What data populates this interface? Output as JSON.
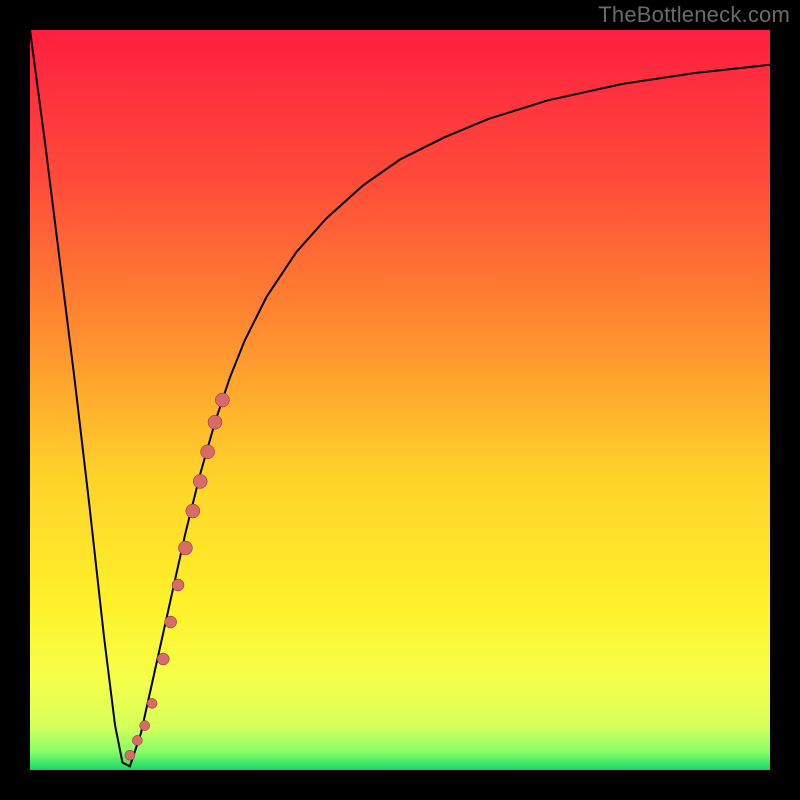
{
  "watermark": "TheBottleneck.com",
  "colors": {
    "curve": "#000000",
    "dot_fill": "#d96a6a",
    "dot_stroke": "#7a2b2b",
    "gradient_stops": [
      {
        "offset": 0.0,
        "color": "#ff1f3f"
      },
      {
        "offset": 0.2,
        "color": "#ff4a3a"
      },
      {
        "offset": 0.4,
        "color": "#ff8a2f"
      },
      {
        "offset": 0.6,
        "color": "#ffd22a"
      },
      {
        "offset": 0.78,
        "color": "#fff22a"
      },
      {
        "offset": 0.88,
        "color": "#f5ff4a"
      },
      {
        "offset": 0.94,
        "color": "#d7ff5a"
      },
      {
        "offset": 0.975,
        "color": "#88ff66"
      },
      {
        "offset": 1.0,
        "color": "#19d66a"
      }
    ]
  },
  "chart_data": {
    "type": "line",
    "title": "",
    "xlabel": "",
    "ylabel": "",
    "xlim": [
      0,
      100
    ],
    "ylim": [
      0,
      100
    ],
    "series": [
      {
        "name": "bottleneck-curve",
        "x": [
          0,
          2,
          4,
          6,
          8,
          10,
          11.5,
          12.5,
          13.5,
          15,
          17,
          19,
          21,
          23,
          25,
          27,
          29,
          32,
          36,
          40,
          45,
          50,
          56,
          62,
          70,
          80,
          90,
          100
        ],
        "y": [
          100,
          85,
          69,
          53,
          36,
          18,
          6,
          1,
          0.5,
          5,
          14,
          23,
          32,
          40,
          47,
          53,
          58,
          64,
          70,
          74.5,
          79,
          82.5,
          85.5,
          88,
          90.5,
          92.7,
          94.2,
          95.3
        ]
      }
    ],
    "dots": {
      "name": "measured-points",
      "x": [
        13.5,
        14.5,
        15.5,
        16.5,
        18,
        19,
        20,
        21,
        22,
        23,
        24,
        25,
        26
      ],
      "y": [
        2,
        4,
        6,
        9,
        15,
        20,
        25,
        30,
        35,
        39,
        43,
        47,
        50
      ],
      "r": [
        5,
        5,
        5,
        5,
        6,
        6,
        6,
        7,
        7,
        7,
        7,
        7,
        7
      ]
    },
    "grid": false,
    "legend": false
  }
}
